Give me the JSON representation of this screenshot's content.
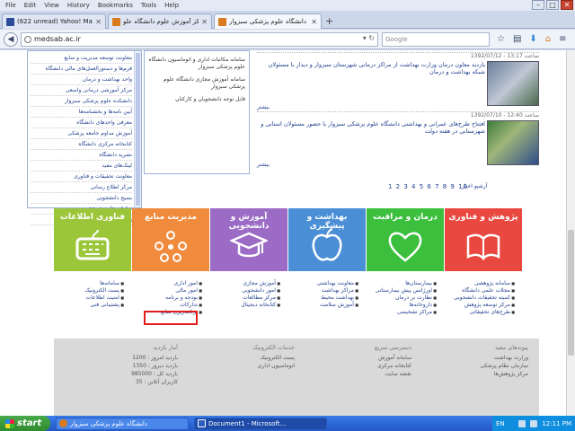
{
  "menubar": {
    "items": [
      "File",
      "Edit",
      "View",
      "History",
      "Bookmarks",
      "Tools",
      "Help"
    ]
  },
  "tabs": [
    {
      "label": "(622 unread) Yahoo! Mail"
    },
    {
      "label": "مرکز آموزش علوم دانشگاه علو..."
    },
    {
      "label": "دانشگاه علوم پزشکی سبزوار"
    }
  ],
  "navbar": {
    "url": "medsab.ac.ir",
    "search_placeholder": "Google"
  },
  "left_list": [
    "معاونت توسعه مدیریت و منابع",
    "فرم‌ها و دستورالعمل‌های مالی دانشگاه",
    "واحد بهداشت و درمان",
    "مرکز آموزشی درمانی واسعی",
    "دانشکده علوم پزشکی سبزوار",
    "آیین نامه‌ها و بخشنامه‌ها",
    "معرفی واحدهای دانشگاه",
    "آموزش مداوم جامعه پزشکی",
    "کتابخانه مرکزی دانشگاه",
    "نشریه دانشگاه",
    "لینک‌های مفید",
    "معاونت تحقیقات و فناوری",
    "مرکز اطلاع رسانی",
    "بسیج دانشجویی",
    "سامانه جامع پژوهشی",
    "پرتال اطلاع رسانی"
  ],
  "mid_col": [
    "سامانه مکاتبات اداری و اتوماسیون دانشگاه علوم پزشکی سبزوار",
    "سامانه آموزش مجازی دانشگاه علوم پزشکی سبزوار",
    "قابل توجه دانشجویان و کارکنان"
  ],
  "news": [
    {
      "meta": "1392/07/12 - ساعت 13:17",
      "title": "بازدید معاون درمان وزارت بهداشت از مراکز درمانی شهرستان سبزوار و دیدار با مسئولان شبکه بهداشت و درمان",
      "more": "بیشتر"
    },
    {
      "meta": "1392/07/10 - ساعت 12:40",
      "title": "افتتاح طرح‌های عمرانی و بهداشتی دانشگاه علوم پزشکی سبزوار با حضور مسئولان استانی و شهرستانی در هفته دولت",
      "more": "بیشتر"
    }
  ],
  "pager": "1 2 3 4 5 6 7 8 9 10",
  "archive_link": "آرشیو اخبار",
  "tiles": [
    {
      "title": "پژوهش و فناوری",
      "color": "#e8483f"
    },
    {
      "title": "درمان و مراقبت",
      "color": "#3bbf3d"
    },
    {
      "title": "بهداشت و پیشگیری",
      "color": "#4a8fd6"
    },
    {
      "title": "آموزش و دانشجویی",
      "color": "#9b6bc6"
    },
    {
      "title": "مدیریت منابع",
      "color": "#f08a3c"
    },
    {
      "title": "فناوری اطلاعات",
      "color": "#9cc63a"
    }
  ],
  "tile_links": [
    [
      "سامانه پژوهشی",
      "مجلات علمی دانشگاه",
      "کمیته تحقیقات دانشجویی",
      "مرکز توسعه پژوهش",
      "طرح‌های تحقیقاتی"
    ],
    [
      "بیمارستان‌ها",
      "اورژانس پیش بیمارستانی",
      "نظارت بر درمان",
      "داروخانه‌ها",
      "مراکز تشخیصی"
    ],
    [
      "معاونت بهداشتی",
      "مراکز بهداشت",
      "بهداشت محیط",
      "آموزش سلامت"
    ],
    [
      "آموزش مجازی",
      "امور دانشجویی",
      "مرکز مطالعات",
      "کتابخانه دیجیتال"
    ],
    [
      "امور اداری",
      "امور مالی",
      "بودجه و برنامه",
      "تدارکات",
      "برنامه‌ریزی منابع"
    ],
    [
      "سامانه‌ها",
      "پست الکترونیک",
      "امنیت اطلاعات",
      "پشتیبانی فنی"
    ]
  ],
  "footer": {
    "cols": [
      {
        "head": "پیوندهای مفید",
        "lines": [
          "وزارت بهداشت",
          "سازمان نظام پزشکی",
          "مرکز پژوهش‌ها"
        ]
      },
      {
        "head": "دسترسی سریع",
        "lines": [
          "سامانه آموزش",
          "کتابخانه مرکزی",
          "نقشه سایت"
        ]
      },
      {
        "head": "خدمات الکترونیک",
        "lines": [
          "پست الکترونیک",
          "اتوماسیون اداری"
        ]
      },
      {
        "head": "آمار بازدید",
        "lines": [
          "بازدید امروز : 1200",
          "بازدید دیروز : 1350",
          "بازدید کل : 985000",
          "کاربران آنلاین : 35"
        ]
      }
    ]
  },
  "taskbar": {
    "start": "start",
    "tasks": [
      "دانشگاه علوم پزشکی سبزوار",
      "Document1 - Microsoft..."
    ],
    "lang": "EN",
    "clock": "12:11 PM"
  },
  "colors": {
    "highlight": "#e21b1b",
    "link": "#1f3f8f"
  }
}
